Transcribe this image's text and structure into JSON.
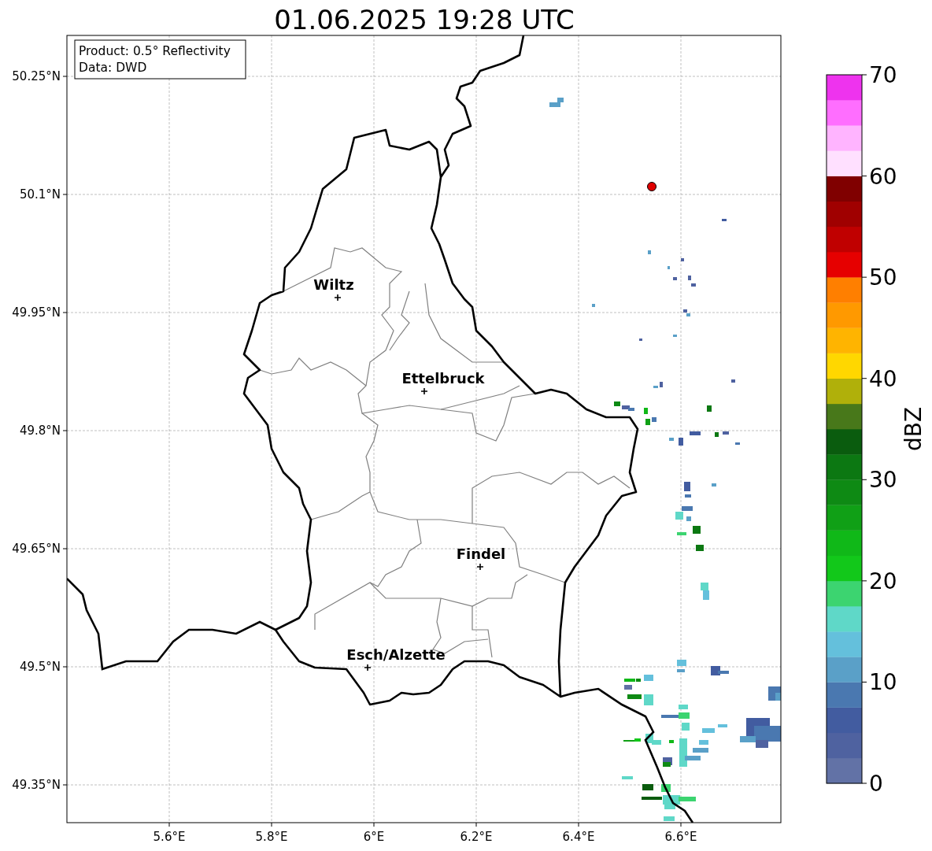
{
  "title": "01.06.2025 19:28 UTC",
  "info_box": [
    "Product: 0.5° Reflectivity",
    "Data: DWD"
  ],
  "map": {
    "lat_ticks": [
      "50.25°N",
      "50.1°N",
      "49.95°N",
      "49.8°N",
      "49.65°N",
      "49.5°N",
      "49.35°N"
    ],
    "lon_ticks": [
      "5.6°E",
      "5.8°E",
      "6°E",
      "6.2°E",
      "6.4°E",
      "6.6°E"
    ],
    "cities": [
      {
        "name": "Wiltz"
      },
      {
        "name": "Ettelbruck"
      },
      {
        "name": "Findel"
      },
      {
        "name": "Esch/Alzette"
      }
    ]
  },
  "colorbar": {
    "label": "dBZ",
    "ticks": [
      "70",
      "60",
      "50",
      "40",
      "30",
      "20",
      "10",
      "0"
    ],
    "bins": [
      {
        "color": "#6272a6"
      },
      {
        "color": "#4f62a0"
      },
      {
        "color": "#425ca0"
      },
      {
        "color": "#4a78b0"
      },
      {
        "color": "#5aa0c8"
      },
      {
        "color": "#64c0dc"
      },
      {
        "color": "#5fd8c8"
      },
      {
        "color": "#3cd470"
      },
      {
        "color": "#12c81a"
      },
      {
        "color": "#10b818"
      },
      {
        "color": "#10a016"
      },
      {
        "color": "#0e8a14"
      },
      {
        "color": "#0c7812"
      },
      {
        "color": "#0a5c0e"
      },
      {
        "color": "#48781a"
      },
      {
        "color": "#b0b00a"
      },
      {
        "color": "#ffd700"
      },
      {
        "color": "#ffb400"
      },
      {
        "color": "#ff9900"
      },
      {
        "color": "#ff7f00"
      },
      {
        "color": "#e60000"
      },
      {
        "color": "#c00000"
      },
      {
        "color": "#a00000"
      },
      {
        "color": "#800000"
      },
      {
        "color": "#ffe0ff"
      },
      {
        "color": "#ffb4ff"
      },
      {
        "color": "#ff6eff"
      },
      {
        "color": "#ee33ee"
      }
    ]
  }
}
